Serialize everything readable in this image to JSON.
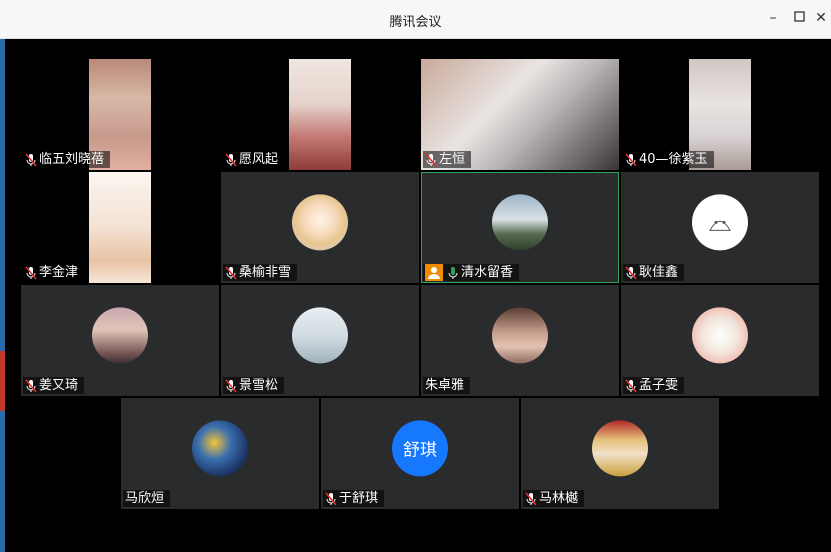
{
  "window": {
    "title": "腾讯会议"
  },
  "participants": [
    {
      "name": "临五刘晓蓓",
      "muted": true
    },
    {
      "name": "愿风起",
      "muted": true
    },
    {
      "name": "左恒",
      "muted": true
    },
    {
      "name": "40—徐紫玉",
      "muted": true
    },
    {
      "name": "李金津",
      "muted": true
    },
    {
      "name": "桑榆非雪",
      "muted": true
    },
    {
      "name": "清水留香",
      "muted": false,
      "speaking": true,
      "host": true
    },
    {
      "name": "耿佳鑫",
      "muted": true
    },
    {
      "name": "姜又琦",
      "muted": true
    },
    {
      "name": "景雪松",
      "muted": true
    },
    {
      "name": "朱卓雅",
      "muted": false
    },
    {
      "name": "孟子雯",
      "muted": true
    },
    {
      "name": "马欣烜",
      "muted": false
    },
    {
      "name": "于舒琪",
      "muted": true,
      "avatar_text": "舒琪"
    },
    {
      "name": "马林樾",
      "muted": true
    }
  ],
  "colors": {
    "tile_bg": "#2a2b2d",
    "active_border": "#2fa35b",
    "avatar_blue": "#1677ff",
    "mic_muted": "#e03030",
    "mic_active": "#2fa35b"
  }
}
